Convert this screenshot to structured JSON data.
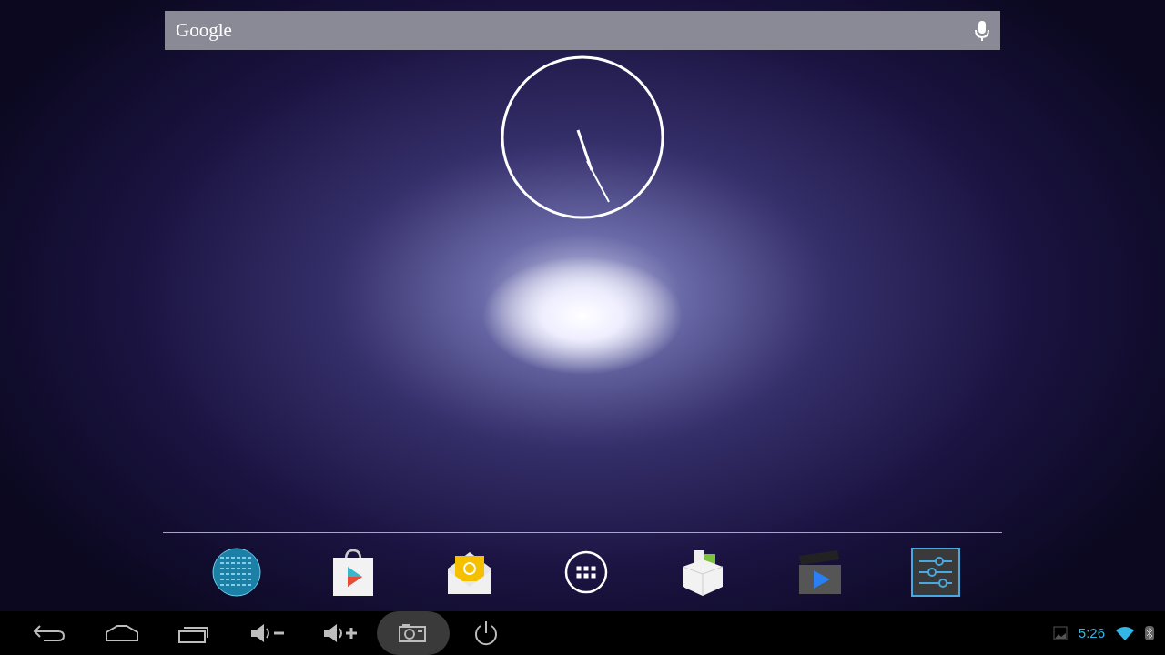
{
  "search_bar": {
    "label": "Google"
  },
  "dock": [
    {
      "kind": "globe"
    },
    {
      "kind": "store"
    },
    {
      "kind": "email"
    },
    {
      "kind": "apps"
    },
    {
      "kind": "box"
    },
    {
      "kind": "video"
    },
    {
      "kind": "settings"
    }
  ],
  "nav_buttons": [
    {
      "kind": "back",
      "selected": false
    },
    {
      "kind": "home",
      "selected": false
    },
    {
      "kind": "recents",
      "selected": false
    },
    {
      "kind": "volume-down",
      "selected": false
    },
    {
      "kind": "volume-up",
      "selected": false
    },
    {
      "kind": "screenshot",
      "selected": true
    },
    {
      "kind": "power",
      "selected": false
    }
  ],
  "status_bar": {
    "time": "5:26"
  }
}
